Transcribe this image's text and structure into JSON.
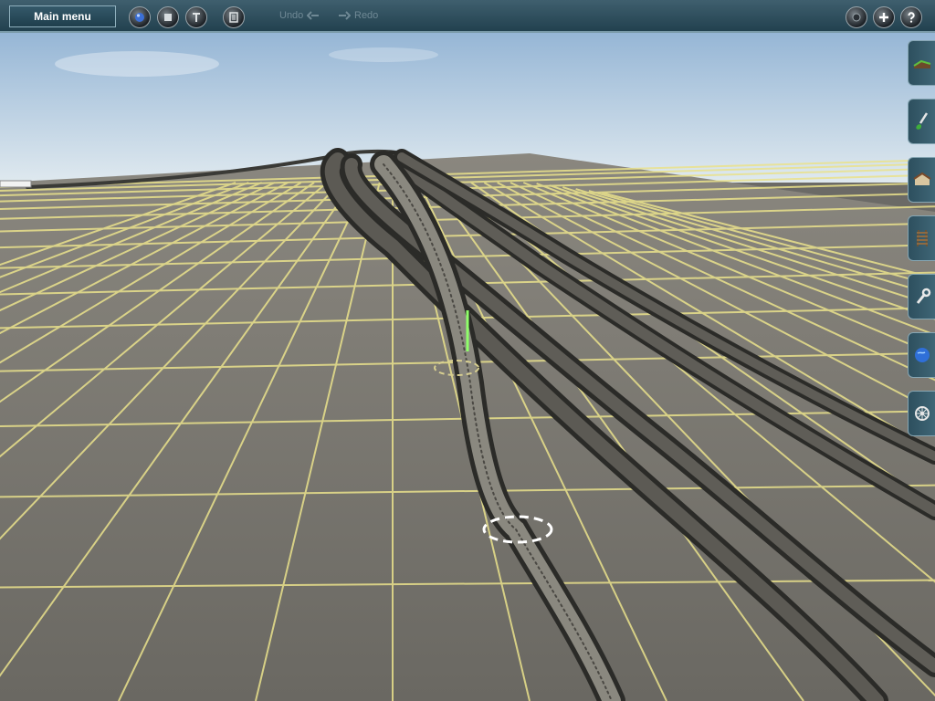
{
  "toolbar": {
    "main_menu_label": "Main menu",
    "undo_label": "Undo",
    "redo_label": "Redo",
    "left_buttons": [
      {
        "name": "view-mode-icon"
      },
      {
        "name": "stop-icon"
      },
      {
        "name": "query-tool-icon"
      },
      {
        "name": "layers-icon"
      }
    ],
    "right_buttons": [
      {
        "name": "minimap-icon"
      },
      {
        "name": "zoom-in-icon"
      },
      {
        "name": "help-icon"
      }
    ]
  },
  "side_tabs": [
    {
      "name": "topology-tab",
      "icon": "terrain-icon"
    },
    {
      "name": "paint-tab",
      "icon": "paint-icon"
    },
    {
      "name": "objects-tab",
      "icon": "house-icon"
    },
    {
      "name": "track-tab",
      "icon": "track-icon"
    },
    {
      "name": "trackside-tab",
      "icon": "wrench-icon"
    },
    {
      "name": "interlocking-tab",
      "icon": "globe-icon"
    },
    {
      "name": "session-tab",
      "icon": "settings-wheel-icon"
    }
  ],
  "colors": {
    "sky_top": "#7fa6cc",
    "sky_bottom": "#d8e6ee",
    "ground": "#6e6c67",
    "grid": "#e8e08a",
    "toolbar": "#2d4d5c"
  }
}
